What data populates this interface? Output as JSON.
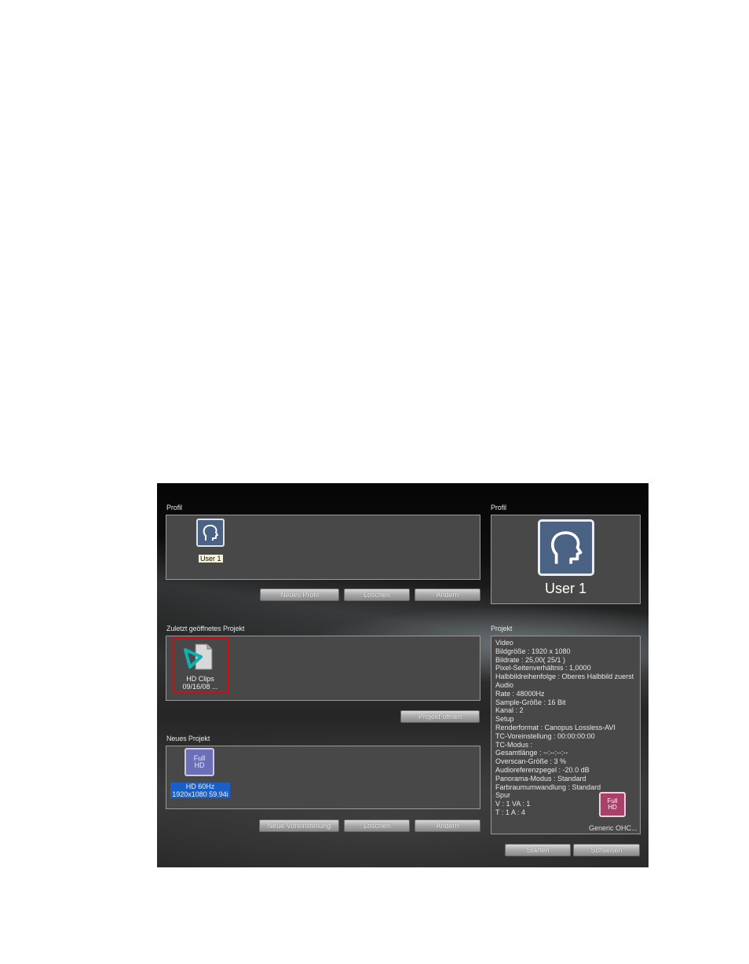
{
  "profile_section": {
    "label": "Profil",
    "item_label": "User 1",
    "buttons": {
      "new": "Neues Profil",
      "delete": "Löschen",
      "edit": "Ändern"
    }
  },
  "profile_preview": {
    "label": "Profil",
    "name": "User 1"
  },
  "recent_section": {
    "label": "Zuletzt geöffnetes Projekt",
    "item_title": "HD Clips",
    "item_date": "09/16/08 ...",
    "open_button": "Projekt öffnen"
  },
  "new_project_section": {
    "label": "Neues Projekt",
    "item_title": "HD 60Hz",
    "item_format": "1920x1080 59.94i",
    "buttons": {
      "new": "Neue Voreinstellung",
      "delete": "Löschen",
      "edit": "Ändern"
    }
  },
  "project_info": {
    "label": "Projekt",
    "lines": [
      "Video",
      "Bildgröße : 1920 x 1080",
      "Bildrate : 25,00( 25/1 )",
      "Pixel-Seitenverhältnis : 1,0000",
      "Halbbildreihenfolge : Oberes Halbbild zuerst",
      "Audio",
      "Rate : 48000Hz",
      "Sample-Größe : 16 Bit",
      "Kanal : 2",
      "Setup",
      "Renderformat : Canopus Lossless-AVI",
      "TC-Voreinstellung : 00:00:00:00",
      "TC-Modus :",
      "Gesamtlänge : --:--:--:--",
      "Overscan-Größe : 3 %",
      "Audioreferenzpegel : -20.0 dB",
      "Panorama-Modus : Standard",
      "Farbraumumwandlung : Standard",
      "Spur",
      "V : 1  VA : 1",
      "T : 1  A : 4"
    ],
    "badge_top": "Full",
    "badge_bottom": "HD",
    "badge_caption": "Generic OHC..."
  },
  "new_item_badge": {
    "top": "Full",
    "bottom": "HD"
  },
  "footer": {
    "start": "Starten",
    "close": "Schließen"
  },
  "colors": {
    "selection": "#1a5fc8",
    "recent_highlight": "#d01010",
    "profile_icon_bg": "#4a6384"
  }
}
